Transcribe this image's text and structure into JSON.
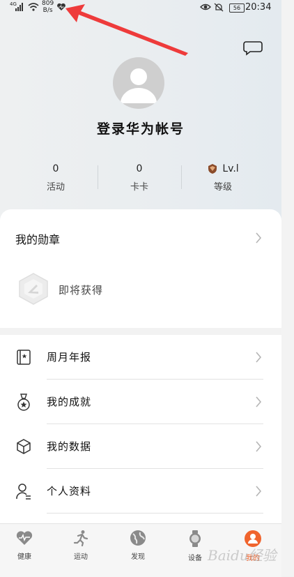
{
  "status_bar": {
    "net_speed_value": "809",
    "net_speed_unit": "B/s",
    "battery": "56",
    "time": "20:34"
  },
  "profile": {
    "login_title": "登录华为帐号"
  },
  "stats": {
    "activity_count": "0",
    "activity_label": "活动",
    "card_count": "0",
    "card_label": "卡卡",
    "level_value": "Lv.l",
    "level_label": "等级"
  },
  "badges": {
    "title": "我的勋章",
    "coming_soon": "即将获得"
  },
  "menu": {
    "items": [
      {
        "label": "周月年报",
        "icon": "report-book-icon"
      },
      {
        "label": "我的成就",
        "icon": "medal-icon"
      },
      {
        "label": "我的数据",
        "icon": "cube-icon"
      },
      {
        "label": "个人资料",
        "icon": "person-icon"
      }
    ]
  },
  "tabs": [
    {
      "label": "健康",
      "icon": "heart-pulse-icon"
    },
    {
      "label": "运动",
      "icon": "runner-icon"
    },
    {
      "label": "发现",
      "icon": "globe-icon"
    },
    {
      "label": "设备",
      "icon": "watch-icon"
    },
    {
      "label": "我的",
      "icon": "profile-icon",
      "active": true
    }
  ],
  "colors": {
    "accent": "#f0642d",
    "arrow": "#ee3b3b"
  },
  "watermark": "Baidu经验"
}
